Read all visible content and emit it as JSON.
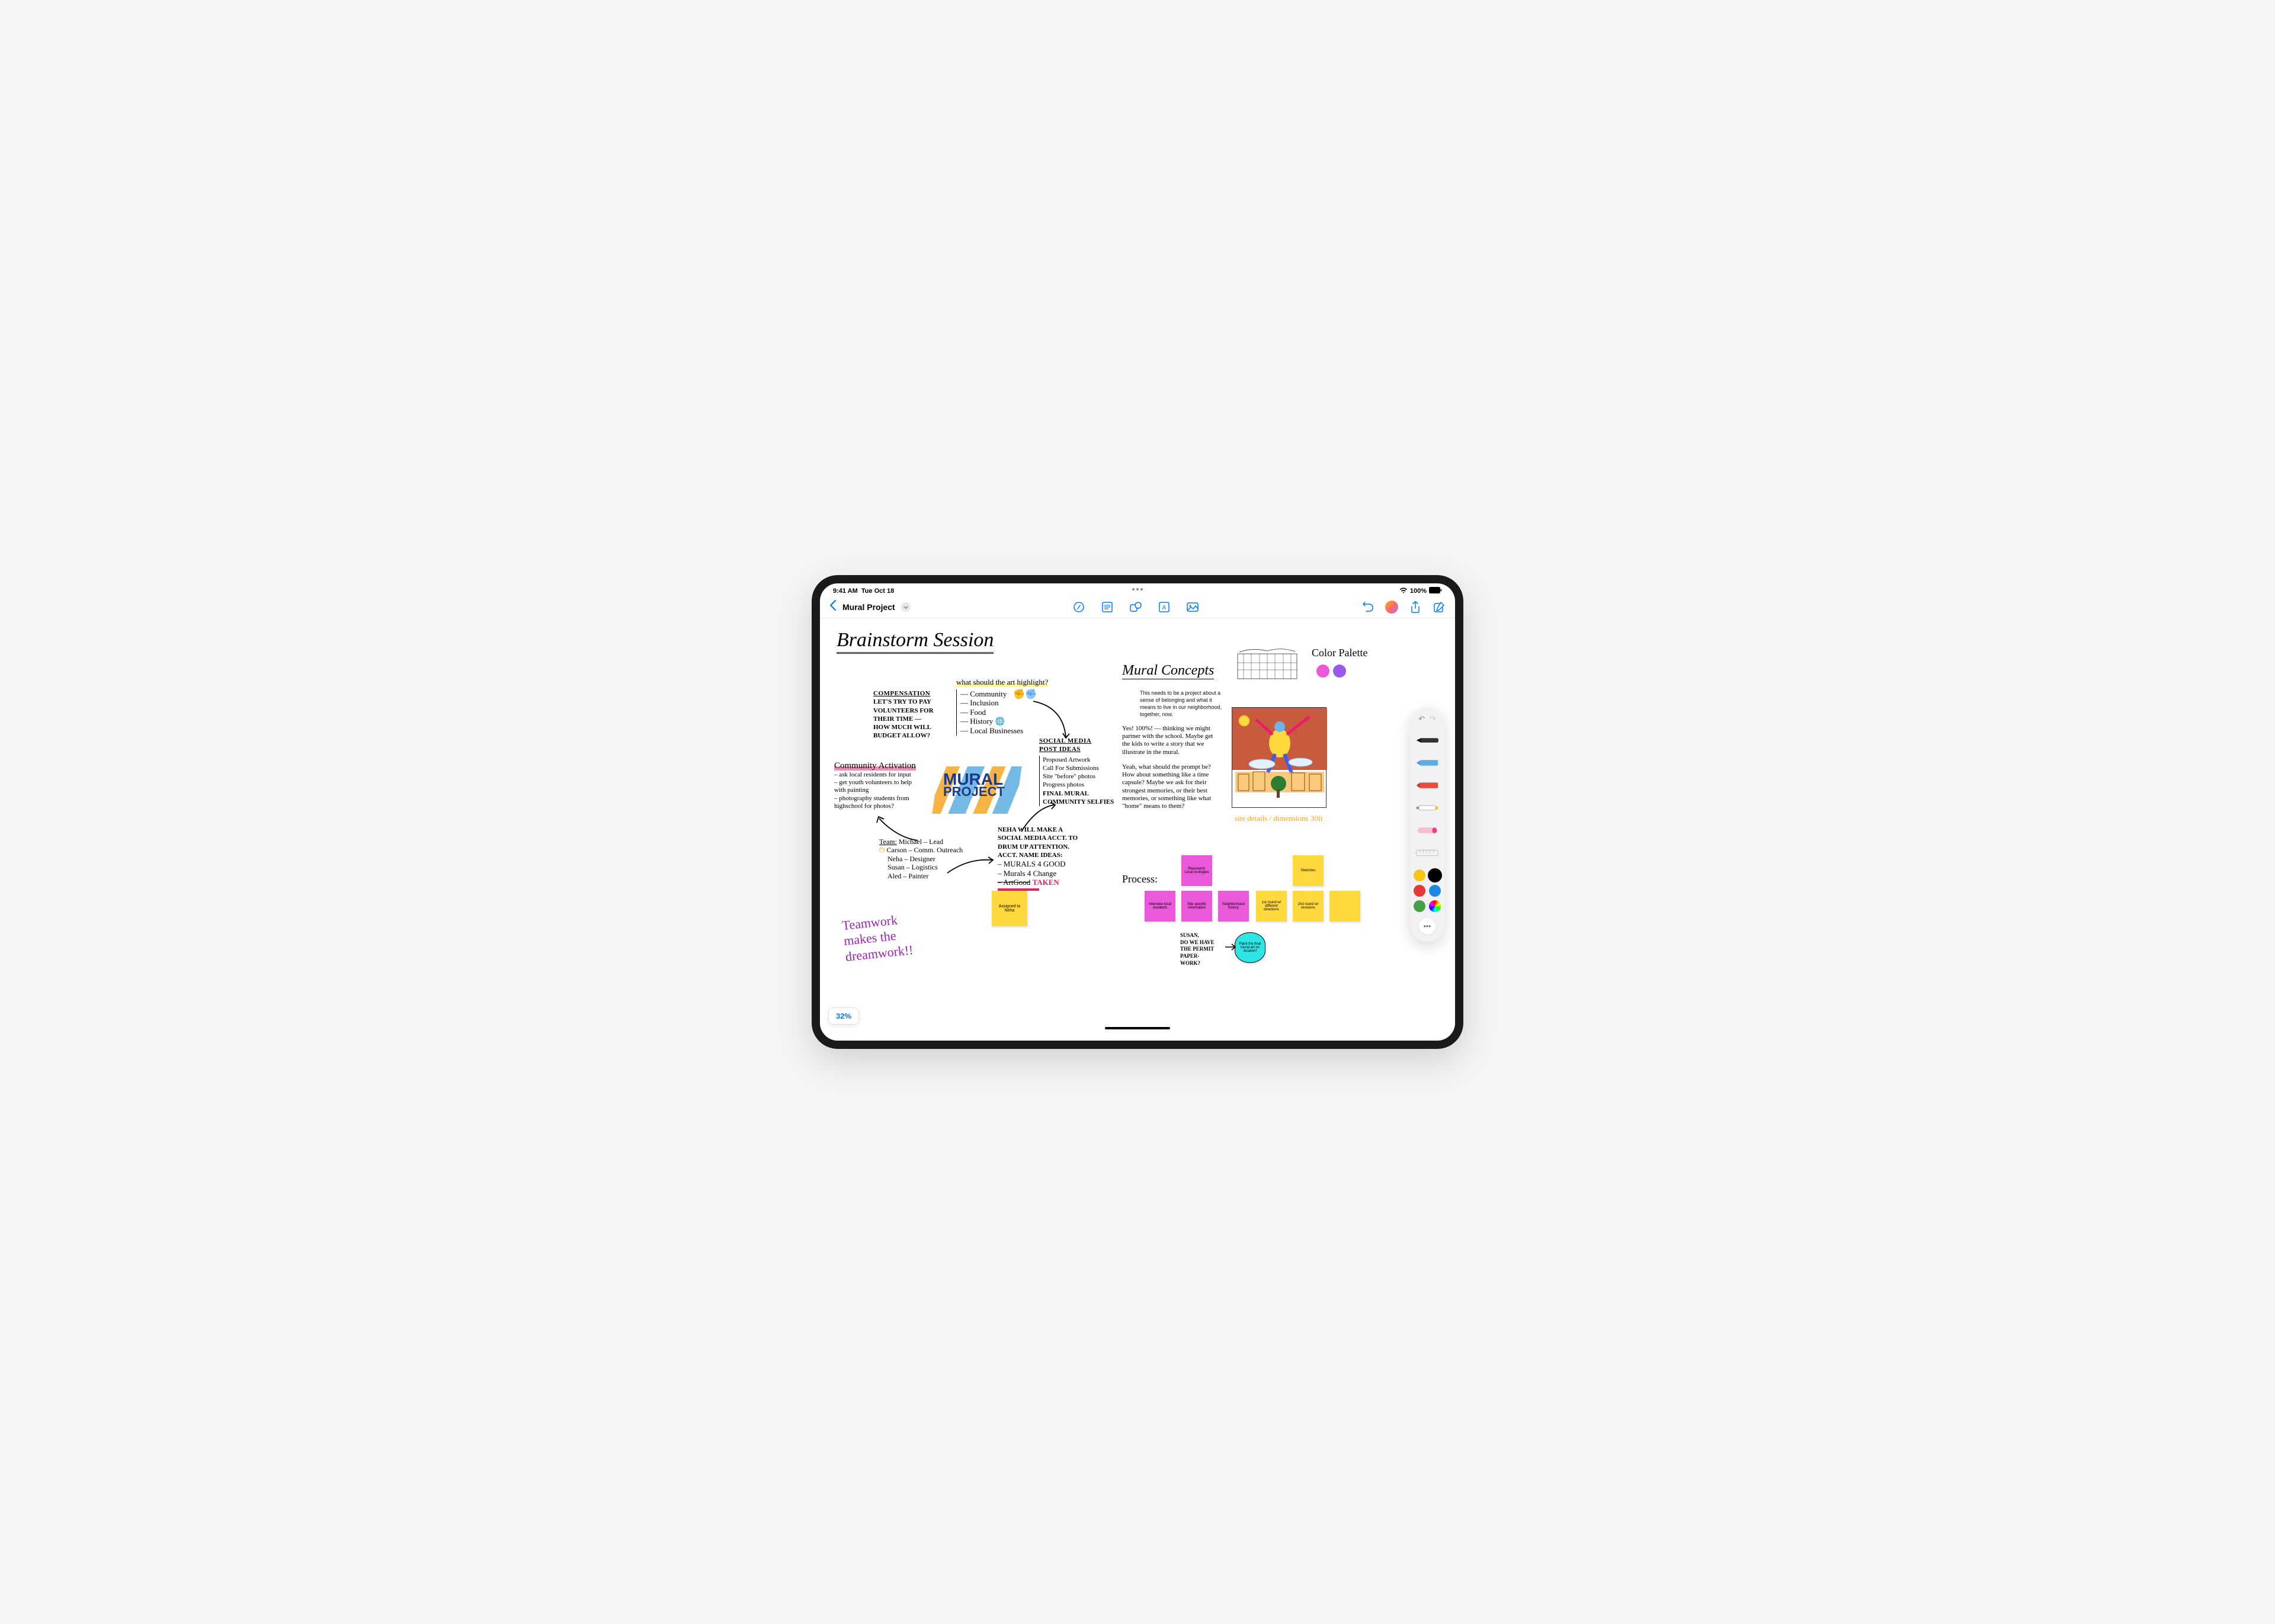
{
  "status_bar": {
    "time": "9:41 AM",
    "date": "Tue Oct 18",
    "battery": "100%"
  },
  "toolbar": {
    "title": "Mural Project"
  },
  "zoom": "32%",
  "headings": {
    "brainstorm": "Brainstorm Session",
    "mural_concepts": "Mural Concepts",
    "color_palette": "Color Palette",
    "process": "Process:"
  },
  "palette_colors": {
    "magenta": "#e959d9",
    "purple": "#9b59e9"
  },
  "blocks": {
    "compensation": {
      "header": "COMPENSATION",
      "body": "LET'S TRY TO PAY\nVOLUNTEERS FOR\nTHEIR TIME —\nHOW MUCH WILL\nBUDGET ALLOW?"
    },
    "highlight": {
      "header": "what should the art highlight?",
      "items": [
        "Community",
        "Inclusion",
        "Food",
        "History",
        "Local Businesses"
      ]
    },
    "social": {
      "header": "SOCIAL MEDIA\nPOST IDEAS",
      "items": [
        "Proposed Artwork",
        "Call For Submissions",
        "Site \"before\" photos",
        "Progress photos",
        "FINAL MURAL",
        "COMMUNITY SELFIES"
      ]
    },
    "community": {
      "header": "Community Activation",
      "items": [
        "ask local residents for input",
        "get youth volunteers to help with painting",
        "photography students from highschool for photos?"
      ]
    },
    "team": {
      "header": "Team:",
      "items": [
        "Michael – Lead",
        "Carson – Comm. Outreach",
        "Neha – Designer",
        "Susan – Logistics",
        "Aled – Painter"
      ]
    },
    "neha": {
      "header": "NEHA WILL MAKE A\nSOCIAL MEDIA ACCT. TO\nDRUM UP ATTENTION.\nACCT. NAME IDEAS:",
      "items": [
        "– MURALS 4 GOOD",
        "– Murals 4 Change",
        "– ArtGood",
        "TAKEN"
      ]
    },
    "typed_note": "This needs to be a project about a sense of belonging and what it means to live in our neighborhood, together, now.",
    "note1": "Yes! 100%! — thinking we might partner with the school. Maybe get the kids to write a story that we illustrate in the mural.",
    "note2": "Yeah, what should the prompt be? How about something like a time capsule? Maybe we ask for their strongest memories, or their best memories, or something like what \"home\" means to them?",
    "site_details": "site details / dimensions 30ft",
    "susan_note": "SUSAN,\nDO WE HAVE\nTHE PERMIT\nPAPER-\nWORK?",
    "teamwork": "Teamwork\nmakes the\ndreamwork!!"
  },
  "mural_logo": {
    "line1": "MURAL",
    "line2": "PROJECT"
  },
  "stickies": {
    "assigned": "Assigned to Neha",
    "research": "Reasearch Local ecologies",
    "sketches": "Sketches",
    "interview": "Interview local residents",
    "siteinfo": "Site specific information",
    "history": "Neighborhood history",
    "round1": "1st round w/ different directions",
    "round2": "2nd round w/ revisions",
    "paint": "Paint the final mural art on location!"
  },
  "tool_colors": [
    "#f5c518",
    "#000000",
    "#e53935",
    "#1e88e5",
    "#43a047"
  ]
}
